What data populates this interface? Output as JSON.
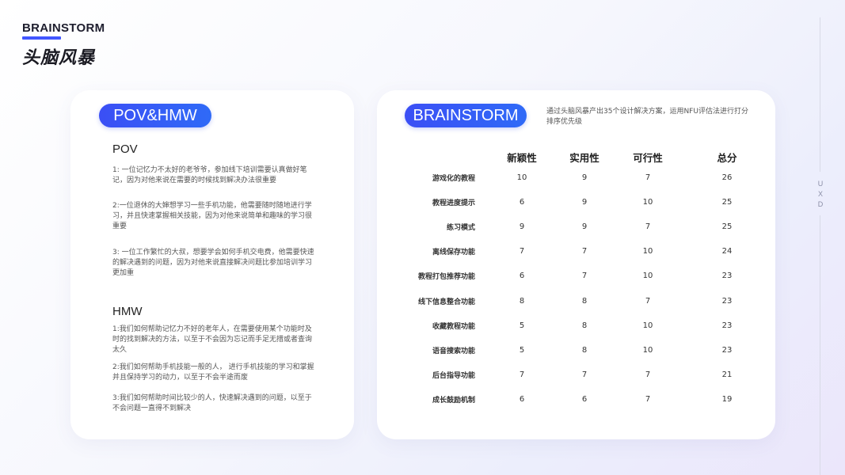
{
  "header": {
    "title_en": "BRAINSTORM",
    "title_cn": "头脑风暴",
    "side_label": "UXD"
  },
  "left_card": {
    "badge": "POV&HMW",
    "pov_heading": "POV",
    "pov_items": [
      "1: 一位记忆力不太好的老爷爷，参加线下培训需要认真做好笔记，因为对他来说在需要的时候找到解决办法很重要",
      "2:一位退休的大婶想学习一些手机功能，他需要随时随地进行学习，并且快速掌握相关技能，因为对他来说简单和趣味的学习很重要",
      "3: 一位工作繁忙的大叔，想要学会如何手机交电费，他需要快速的解决遇到的问题，因为对他来说直接解决问题比参加培训学习更加重"
    ],
    "hmw_heading": "HMW",
    "hmw_items": [
      "1:我们如何帮助记忆力不好的老年人，在需要使用某个功能时及时的找到解决的方法，以至于不会因为忘记而手足无措或者查询太久",
      "2:我们如何帮助手机技能一般的人， 进行手机技能的学习和掌握并且保持学习的动力，以至于不会半途而废",
      "3:我们如何帮助时间比较少的人，快速解决遇到的问题，以至于不会问题一直得不到解决"
    ]
  },
  "right_card": {
    "badge": "BRAINSTORM",
    "intro": "通过头脑风暴产出35个设计解决方案，运用NFU评估法进行打分排序优先级",
    "columns": [
      "新颖性",
      "实用性",
      "可行性",
      "总分"
    ],
    "rows": [
      {
        "name": "游戏化的教程",
        "values": [
          "10",
          "9",
          "7",
          "26"
        ]
      },
      {
        "name": "教程进度提示",
        "values": [
          "6",
          "9",
          "10",
          "25"
        ]
      },
      {
        "name": "练习模式",
        "values": [
          "9",
          "9",
          "7",
          "25"
        ]
      },
      {
        "name": "离线保存功能",
        "values": [
          "7",
          "7",
          "10",
          "24"
        ]
      },
      {
        "name": "教程打包推荐功能",
        "values": [
          "6",
          "7",
          "10",
          "23"
        ]
      },
      {
        "name": "线下信息整合功能",
        "values": [
          "8",
          "8",
          "7",
          "23"
        ]
      },
      {
        "name": "收藏教程功能",
        "values": [
          "5",
          "8",
          "10",
          "23"
        ]
      },
      {
        "name": "语音搜索功能",
        "values": [
          "5",
          "8",
          "10",
          "23"
        ]
      },
      {
        "name": "后台指导功能",
        "values": [
          "7",
          "7",
          "7",
          "21"
        ]
      },
      {
        "name": "成长鼓励机制",
        "values": [
          "6",
          "6",
          "7",
          "19"
        ]
      }
    ]
  },
  "colors": {
    "accent": "#3b4ff5",
    "accent_bar": "#4257ff"
  }
}
